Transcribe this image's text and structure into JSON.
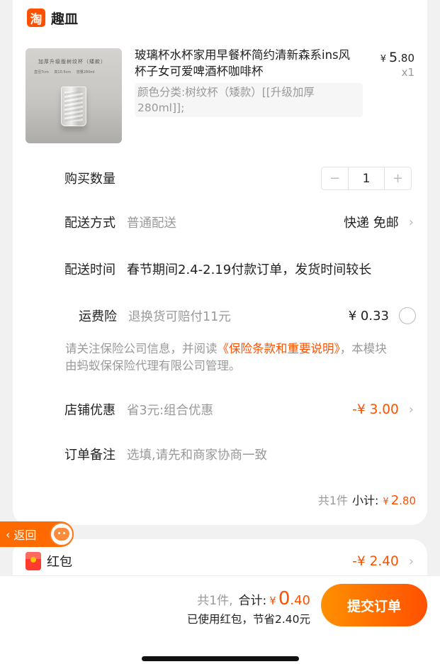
{
  "shop": {
    "logo_char": "淘",
    "name": "趣皿"
  },
  "product": {
    "thumb_line1": "加厚升级版树纹杯（矮款）",
    "thumb_line2": "直径7cm  高10.5cm  容量280ml",
    "title": "玻璃杯水杯家用早餐杯简约清新森系ins风杯子女可爱啤酒杯咖啡杯",
    "spec": "颜色分类:树纹杯（矮款）[[升级加厚280ml]];",
    "price_currency": "¥",
    "price_int": "5",
    "price_dec": ".80",
    "qty_label": "x1"
  },
  "quantity": {
    "label": "购买数量",
    "minus": "−",
    "value": "1",
    "plus": "+"
  },
  "delivery": {
    "label": "配送方式",
    "type": "普通配送",
    "method": "快递 免邮"
  },
  "delivery_time": {
    "label": "配送时间",
    "text": "春节期间2.4-2.19付款订单，发货时间较长"
  },
  "shipping_insurance": {
    "label": "运费险",
    "desc": "退换货可赔付11元",
    "price": "¥ 0.33",
    "notice_pre": "请关注保险公司信息，并阅读",
    "notice_link": "《保险条款和重要说明》",
    "notice_post": "，本模块由蚂蚁保保险代理有限公司管理。"
  },
  "shop_discount": {
    "label": "店铺优惠",
    "desc": "省3元:组合优惠",
    "amount": "-¥ 3.00"
  },
  "order_note": {
    "label": "订单备注",
    "placeholder": "选填,请先和商家协商一致"
  },
  "subtotal": {
    "count": "共1件",
    "label": "小计:",
    "currency": "¥",
    "int": "2",
    "dec": ".80"
  },
  "back": {
    "label": "返回"
  },
  "red_packet": {
    "label": "红包",
    "amount": "-¥ 2.40"
  },
  "footer": {
    "count": "共1件,",
    "total_label": "合计:",
    "currency": "¥",
    "int": "0",
    "dec": ".40",
    "saved": "已使用红包，节省2.40元",
    "submit": "提交订单"
  },
  "colors": {
    "accent": "#ff5000",
    "muted": "#999999",
    "background": "#f1f1f1"
  },
  "icons": [
    "taobao-logo-icon",
    "chevron-right-icon",
    "radio-icon",
    "back-arrow-icon",
    "mascot-icon",
    "red-packet-icon"
  ]
}
